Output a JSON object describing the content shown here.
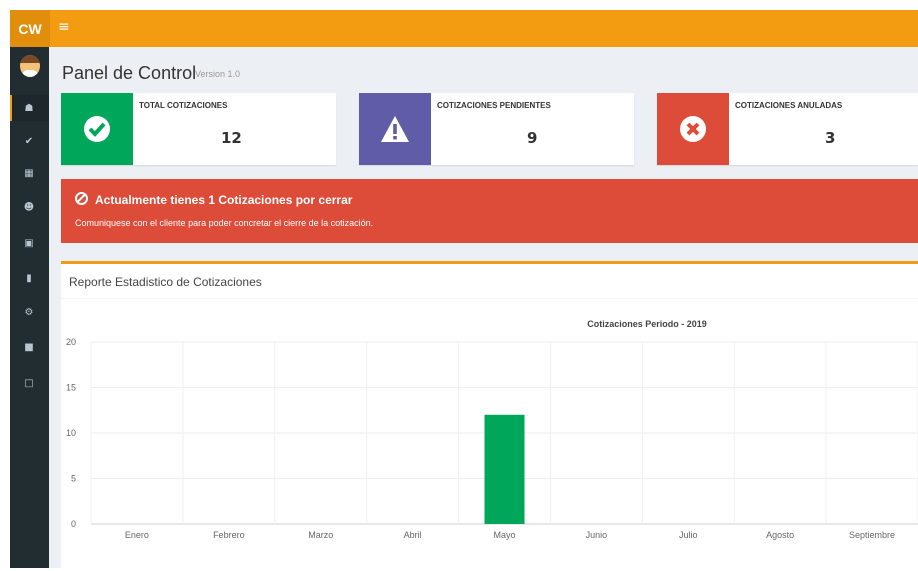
{
  "app": {
    "logo": "CW",
    "menu_icon": "hamburger-icon"
  },
  "sidebar": {
    "items": [
      {
        "icon": "home-icon"
      },
      {
        "icon": "check-circle-icon"
      },
      {
        "icon": "grid-icon"
      },
      {
        "icon": "users-icon"
      },
      {
        "icon": "calendar-icon"
      },
      {
        "icon": "bar-chart-icon"
      },
      {
        "icon": "gear-icon"
      },
      {
        "icon": "lock-icon"
      },
      {
        "icon": "file-icon"
      }
    ]
  },
  "header": {
    "title": "Panel de Control",
    "version": "Version 1.0"
  },
  "info_boxes": [
    {
      "label": "TOTAL COTIZACIONES",
      "value": "12",
      "color": "#00a65a",
      "icon": "check-icon"
    },
    {
      "label": "COTIZACIONES PENDIENTES",
      "value": "9",
      "color": "#605ca8",
      "icon": "warning-icon"
    },
    {
      "label": "COTIZACIONES ANULADAS",
      "value": "3",
      "color": "#dd4b39",
      "icon": "x-circle-icon"
    }
  ],
  "alert": {
    "title": "Actualmente tienes 1 Cotizaciones por cerrar",
    "text": "Comuniquese con el cliente para poder concretar el cierre de la cotización."
  },
  "report": {
    "title": "Reporte Estadistico de Cotizaciones"
  },
  "chart_data": {
    "type": "bar",
    "title": "Cotizaciones Periodo - 2019",
    "categories": [
      "Enero",
      "Febrero",
      "Marzo",
      "Abril",
      "Mayo",
      "Junio",
      "Julio",
      "Agosto",
      "Septiembre"
    ],
    "values": [
      0,
      0,
      0,
      0,
      12,
      0,
      0,
      0,
      0
    ],
    "ylim": [
      0,
      20
    ],
    "yticks": [
      0,
      5,
      10,
      15,
      20
    ],
    "color": "#00a65a",
    "grid": true
  }
}
